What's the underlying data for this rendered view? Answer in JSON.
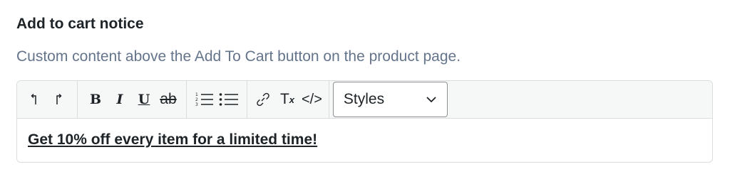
{
  "field": {
    "title": "Add to cart notice",
    "description": "Custom content above the Add To Cart button on the product page."
  },
  "toolbar": {
    "undo_icon": "undo-icon",
    "redo_icon": "redo-icon",
    "bold_label": "B",
    "italic_label": "I",
    "underline_label": "U",
    "strikethrough_label": "ab",
    "ordered_list_icon": "numbered-list-icon",
    "bullet_list_icon": "bullet-list-icon",
    "link_icon": "link-icon",
    "clear_format_label": "T",
    "clear_format_sub": "x",
    "code_label": "</>",
    "styles_select": {
      "value": "Styles"
    }
  },
  "editor": {
    "content": "Get 10% off every item for a limited time!"
  }
}
